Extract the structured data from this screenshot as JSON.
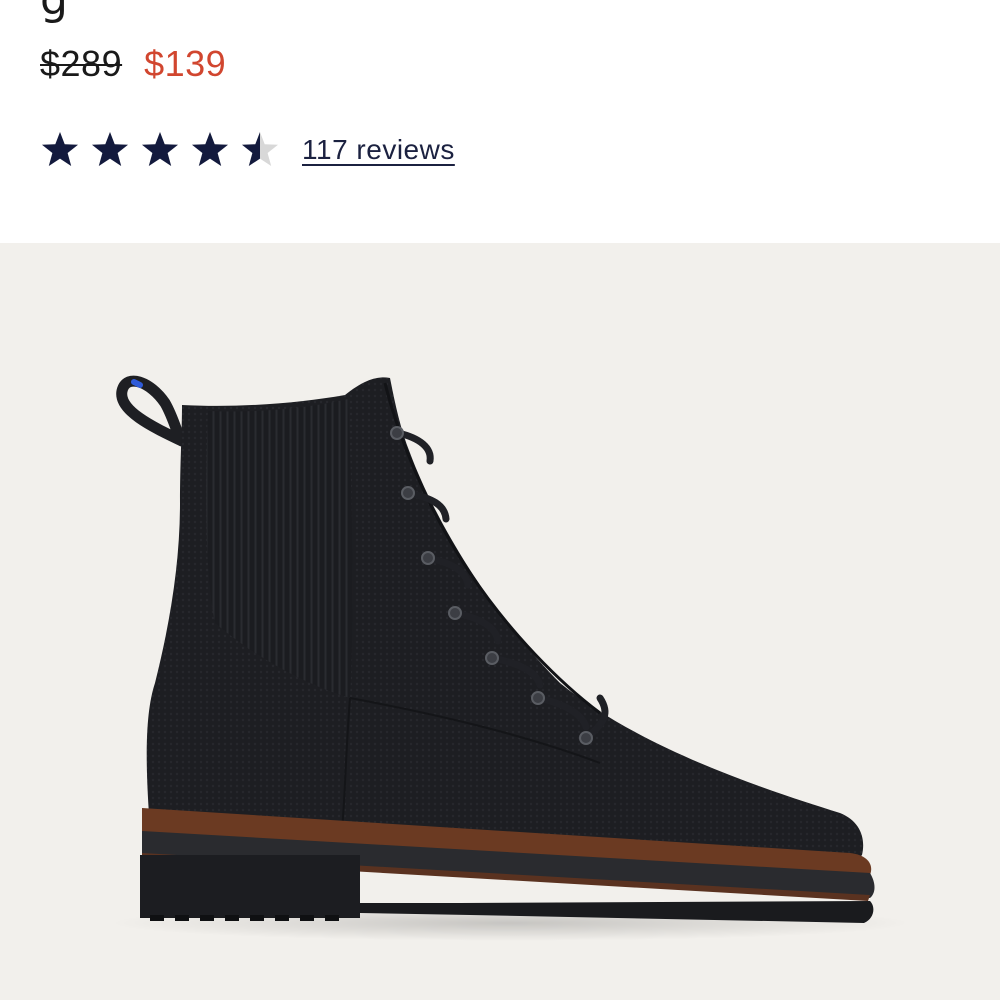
{
  "product": {
    "price_original": "$289",
    "price_sale": "$139",
    "rating": 4.5,
    "rating_max": 5,
    "reviews_link": "117 reviews",
    "image_alt": "Black knit lace-up ankle boot",
    "colors": {
      "star": "#131a3d",
      "star_empty": "#d8d8d8",
      "sale_price": "#d1462f",
      "image_background": "#f2f0ec",
      "boot": "#1c1d20",
      "sole_accent": "#6b3a22"
    }
  }
}
